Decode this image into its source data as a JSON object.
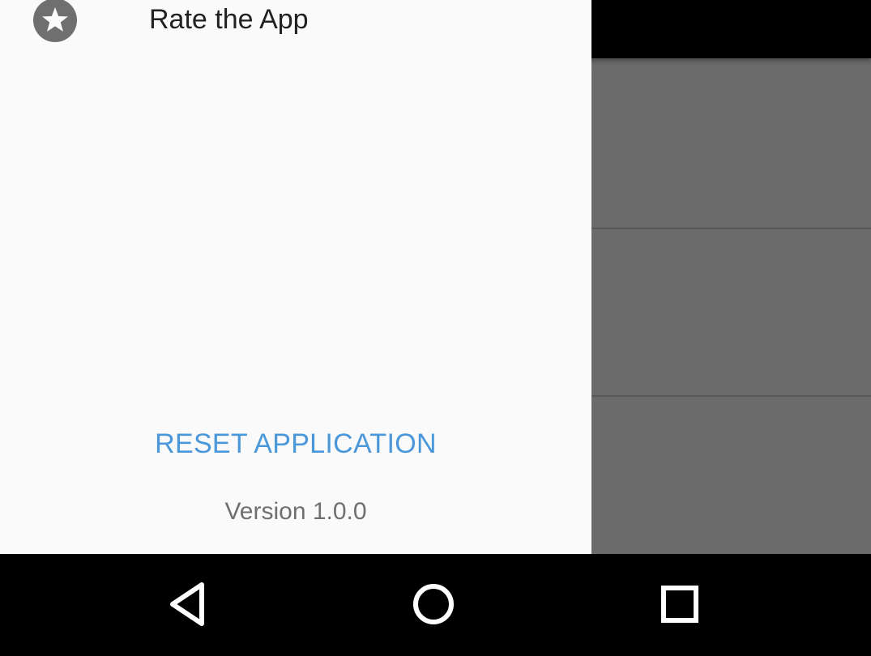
{
  "drawer": {
    "items": [
      {
        "label": "Rate the App",
        "icon": "star-icon"
      }
    ],
    "reset_label": "RESET APPLICATION",
    "version_text": "Version 1.0.0"
  },
  "system_nav": {
    "buttons": [
      "back-icon",
      "home-icon",
      "recents-icon"
    ]
  },
  "colors": {
    "drawer_background": "#fafafa",
    "accent": "#4a97d9",
    "scrim_content": "#6b6b6b",
    "toolbar": "#000000",
    "navbar": "#000000"
  }
}
